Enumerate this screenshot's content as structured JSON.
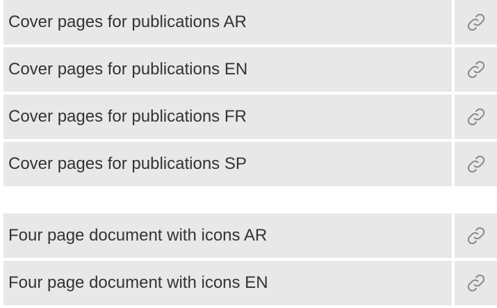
{
  "groups": [
    {
      "rows": [
        {
          "label": "Cover pages for publications AR",
          "icon": "link-icon"
        },
        {
          "label": "Cover pages for publications EN",
          "icon": "link-icon"
        },
        {
          "label": "Cover pages for publications FR",
          "icon": "link-icon"
        },
        {
          "label": "Cover pages for publications SP",
          "icon": "link-icon"
        }
      ]
    },
    {
      "rows": [
        {
          "label": "Four page document with icons AR",
          "icon": "link-icon"
        },
        {
          "label": "Four page document with icons EN",
          "icon": "link-icon"
        }
      ]
    }
  ],
  "colors": {
    "row_background": "#e8e8e8",
    "text": "#333333",
    "icon_stroke": "#8a8a8a"
  }
}
